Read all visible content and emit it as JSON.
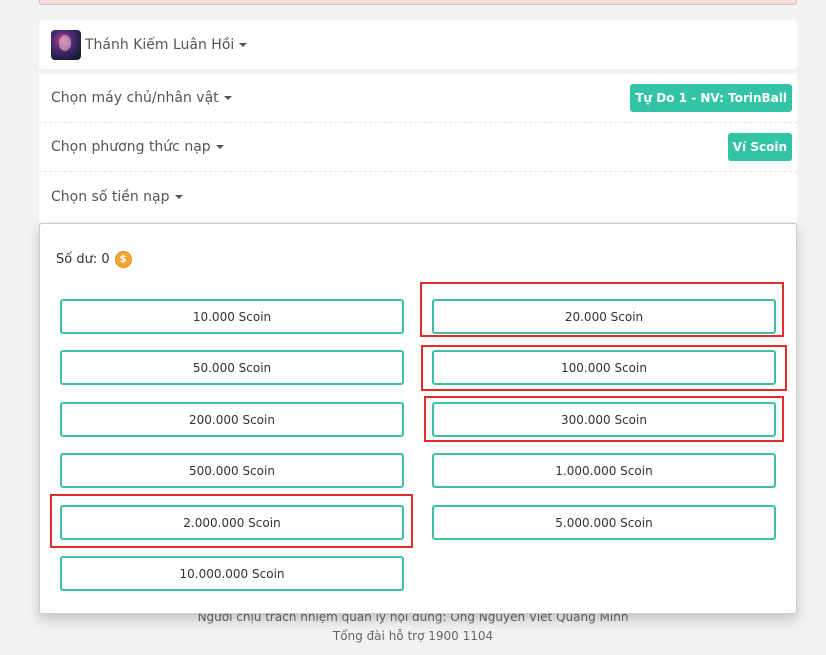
{
  "game": {
    "name": "Thánh Kiếm Luân Hồi"
  },
  "server_row": {
    "label": "Chọn máy chủ/nhân vật",
    "value": "Tự Do 1 - NV: TorinBall"
  },
  "method_row": {
    "label": "Chọn phương thức nạp",
    "value": "Ví Scoin"
  },
  "amount_row": {
    "label": "Chọn số tiền nạp"
  },
  "dropdown": {
    "balance_label": "Số dư: 0",
    "coin_symbol": "$",
    "amounts": [
      "10.000 Scoin",
      "20.000 Scoin",
      "50.000 Scoin",
      "100.000 Scoin",
      "200.000 Scoin",
      "300.000 Scoin",
      "500.000 Scoin",
      "1.000.000 Scoin",
      "2.000.000 Scoin",
      "5.000.000 Scoin",
      "10.000.000 Scoin"
    ]
  },
  "footer": {
    "responsible": "Người chịu trách nhiệm quản lý nội dung: Ông Nguyễn Viết Quang Minh",
    "hotline": "Tổng đài hỗ trợ 1900 1104"
  },
  "colors": {
    "accent": "#33c3a5",
    "highlight": "#e32b2b"
  }
}
